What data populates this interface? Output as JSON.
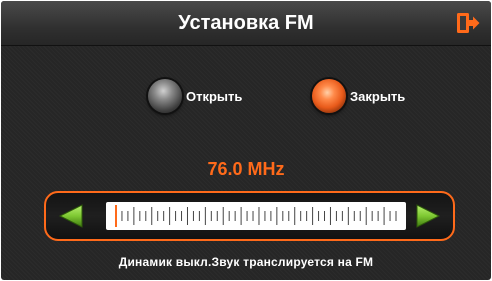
{
  "header": {
    "title": "Установка FM",
    "exit_icon": "exit-door-icon"
  },
  "radio": {
    "selected": "close",
    "options": [
      {
        "key": "open",
        "label": "Открыть",
        "selected": false
      },
      {
        "key": "close",
        "label": "Закрыть",
        "selected": true
      }
    ]
  },
  "tuner": {
    "frequency_label": "76.0 MHz",
    "frequency_mhz": 76.0,
    "range_mhz": [
      76.0,
      108.0
    ],
    "left_icon": "arrow-left-icon",
    "right_icon": "arrow-right-icon"
  },
  "status": {
    "text": "Динамик выкл.Звук транслируется на FM"
  },
  "colors": {
    "accent": "#ff6a1a",
    "arrow_green": "#7ec832",
    "background": "#2a2a2a"
  }
}
